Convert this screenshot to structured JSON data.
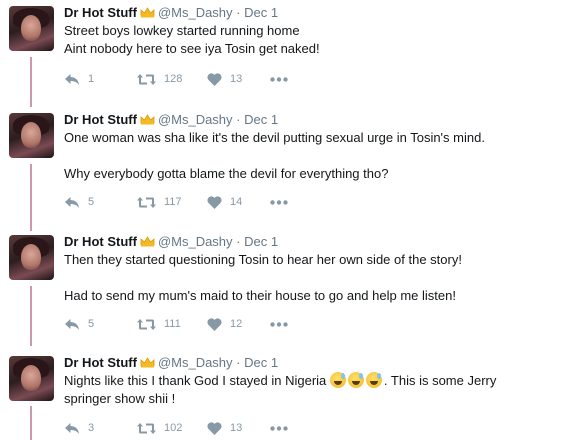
{
  "tweets": [
    {
      "name": "Dr Hot Stuff",
      "handle": "@Ms_Dashy",
      "separator": "·",
      "date": "Dec 1",
      "lines": [
        "Street boys lowkey started running home",
        "Aint nobody here to see iya Tosin get naked!"
      ],
      "replies": "1",
      "retweets": "128",
      "likes": "13"
    },
    {
      "name": "Dr Hot Stuff",
      "handle": "@Ms_Dashy",
      "separator": "·",
      "date": "Dec 1",
      "lines": [
        "One woman was sha like it's the devil putting sexual urge in Tosin's mind.",
        "Why everybody gotta blame the devil for everything tho?"
      ],
      "replies": "5",
      "retweets": "117",
      "likes": "14"
    },
    {
      "name": "Dr Hot Stuff",
      "handle": "@Ms_Dashy",
      "separator": "·",
      "date": "Dec 1",
      "lines": [
        "Then they started questioning Tosin to hear her own side of the story!",
        "Had to send my mum's maid to their house to go and help me listen!"
      ],
      "replies": "5",
      "retweets": "111",
      "likes": "12"
    },
    {
      "name": "Dr Hot Stuff",
      "handle": "@Ms_Dashy",
      "separator": "·",
      "date": "Dec 1",
      "line_before_emoji": "Nights like this I thank God I stayed in Nigeria",
      "line_after_emoji": ".  This is some Jerry",
      "line2": "springer show shii !",
      "emoji": "grinning-sweat-face-emoji",
      "replies": "3",
      "retweets": "102",
      "likes": "13"
    }
  ],
  "colors": {
    "thread_line": "#cc99aa",
    "meta_gray": "#657786",
    "action_gray": "#8899a6",
    "crown": "#f5b921"
  },
  "icons": [
    "reply-icon",
    "retweet-icon",
    "heart-icon",
    "more-icon",
    "crown-icon"
  ]
}
